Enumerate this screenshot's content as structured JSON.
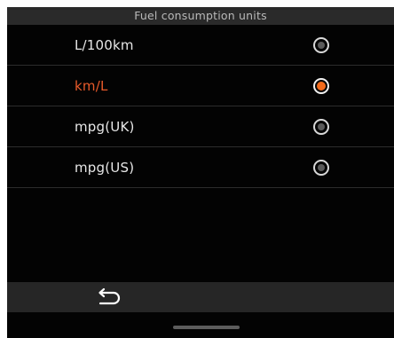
{
  "header": {
    "title": "Fuel consumption units"
  },
  "options": [
    {
      "label": "L/100km",
      "selected": false
    },
    {
      "label": "km/L",
      "selected": true
    },
    {
      "label": "mpg(UK)",
      "selected": false
    },
    {
      "label": "mpg(US)",
      "selected": false
    }
  ],
  "colors": {
    "accent": "#f26a1b",
    "selected_text": "#e85a2a",
    "background": "#030303",
    "bar": "#2a2a2a"
  },
  "icons": {
    "back": "back-arrow-icon"
  }
}
